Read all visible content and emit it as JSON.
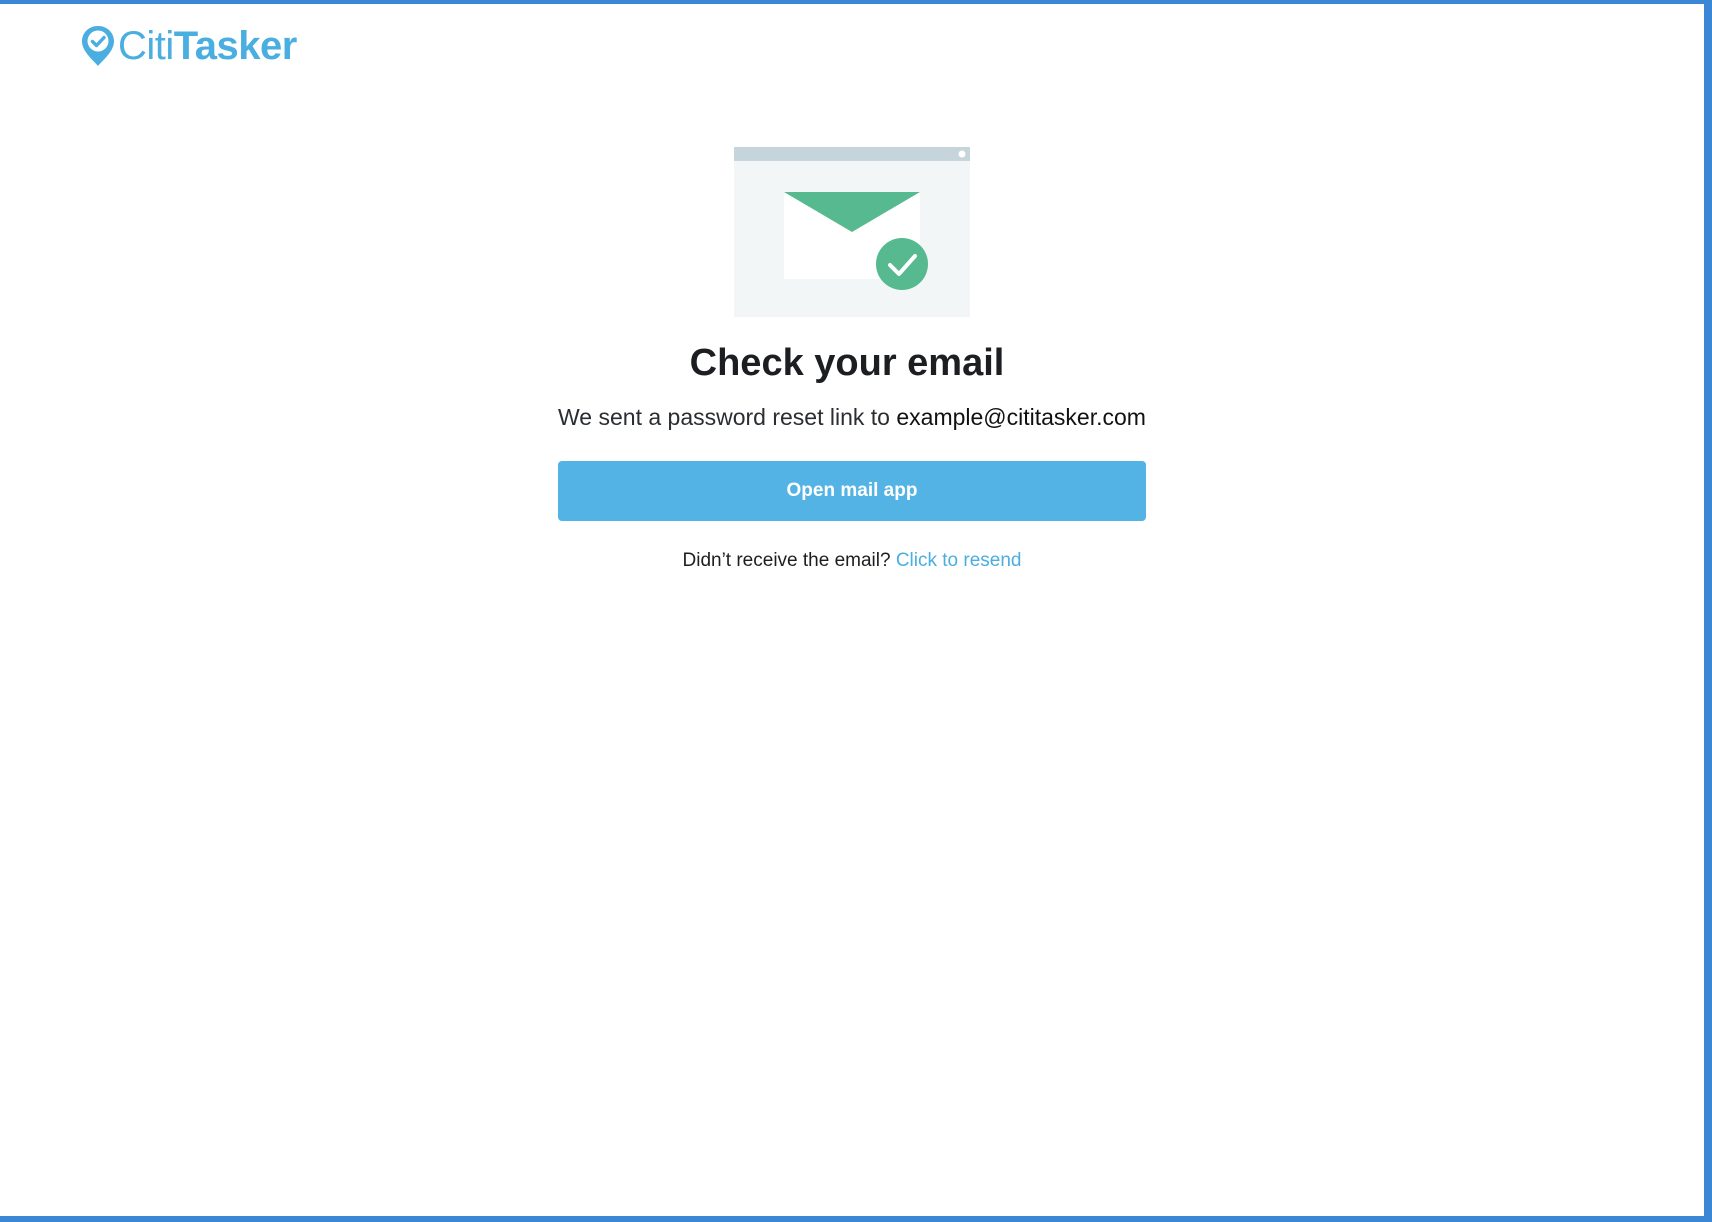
{
  "brand": {
    "name_light": "Citi",
    "name_bold": "Tasker",
    "color": "#4baee0",
    "icon": "location-pin-check-icon"
  },
  "illustration": {
    "icon": "email-sent-check-icon",
    "envelope_color": "#56b98f",
    "check_color": "#56b98f"
  },
  "main": {
    "title": "Check your email",
    "message_prefix": "We sent a password reset link to",
    "email": "example@cititasker.com",
    "open_mail_label": "Open mail app",
    "resend_prompt": "Didn’t receive the email?",
    "resend_link": "Click to resend"
  },
  "colors": {
    "primary": "#54b3e5",
    "frame_border": "#3b87d6"
  }
}
